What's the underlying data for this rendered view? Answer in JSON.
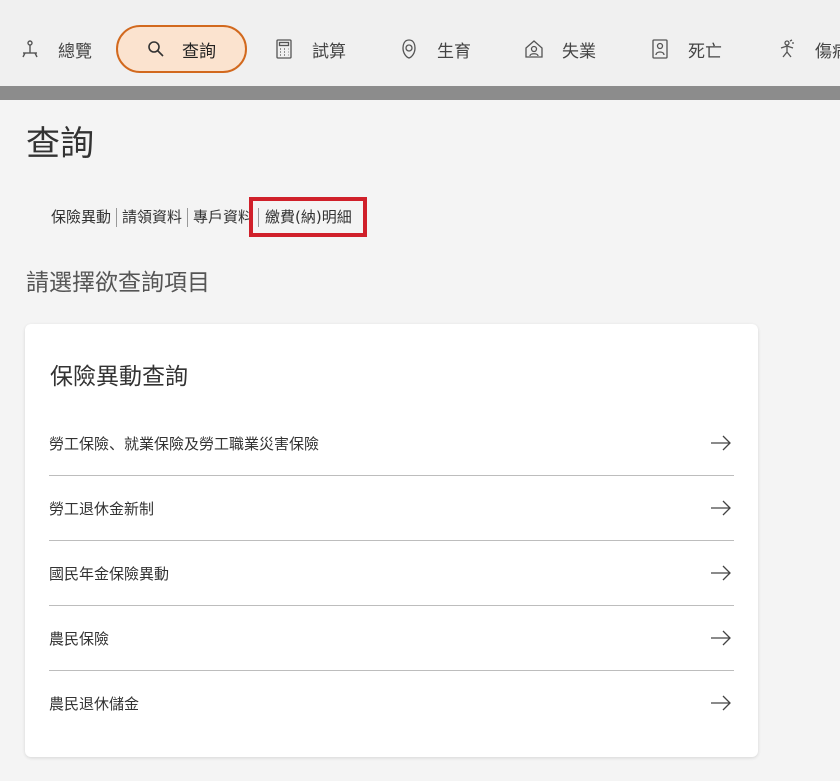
{
  "nav": {
    "items": [
      {
        "label": "總覽",
        "icon": "overview-icon"
      },
      {
        "label": "查詢",
        "icon": "search-icon",
        "active": true
      },
      {
        "label": "試算",
        "icon": "calculator-icon"
      },
      {
        "label": "生育",
        "icon": "birth-icon"
      },
      {
        "label": "失業",
        "icon": "unemployment-icon"
      },
      {
        "label": "死亡",
        "icon": "death-icon"
      },
      {
        "label": "傷病",
        "icon": "injury-icon"
      }
    ],
    "accent_color": "#d2691e",
    "active_bg": "#fbe3cf"
  },
  "page": {
    "title": "查詢",
    "subtabs": [
      "保險異動",
      "請領資料",
      "專戶資料",
      "繳費(納)明細"
    ],
    "highlight_color": "#d0202a",
    "section_heading": "請選擇欲查詢項目"
  },
  "card": {
    "title": "保險異動查詢",
    "items": [
      "勞工保險、就業保險及勞工職業災害保險",
      "勞工退休金新制",
      "國民年金保險異動",
      "農民保險",
      "農民退休儲金"
    ],
    "row_icon": "arrow-right-icon"
  }
}
